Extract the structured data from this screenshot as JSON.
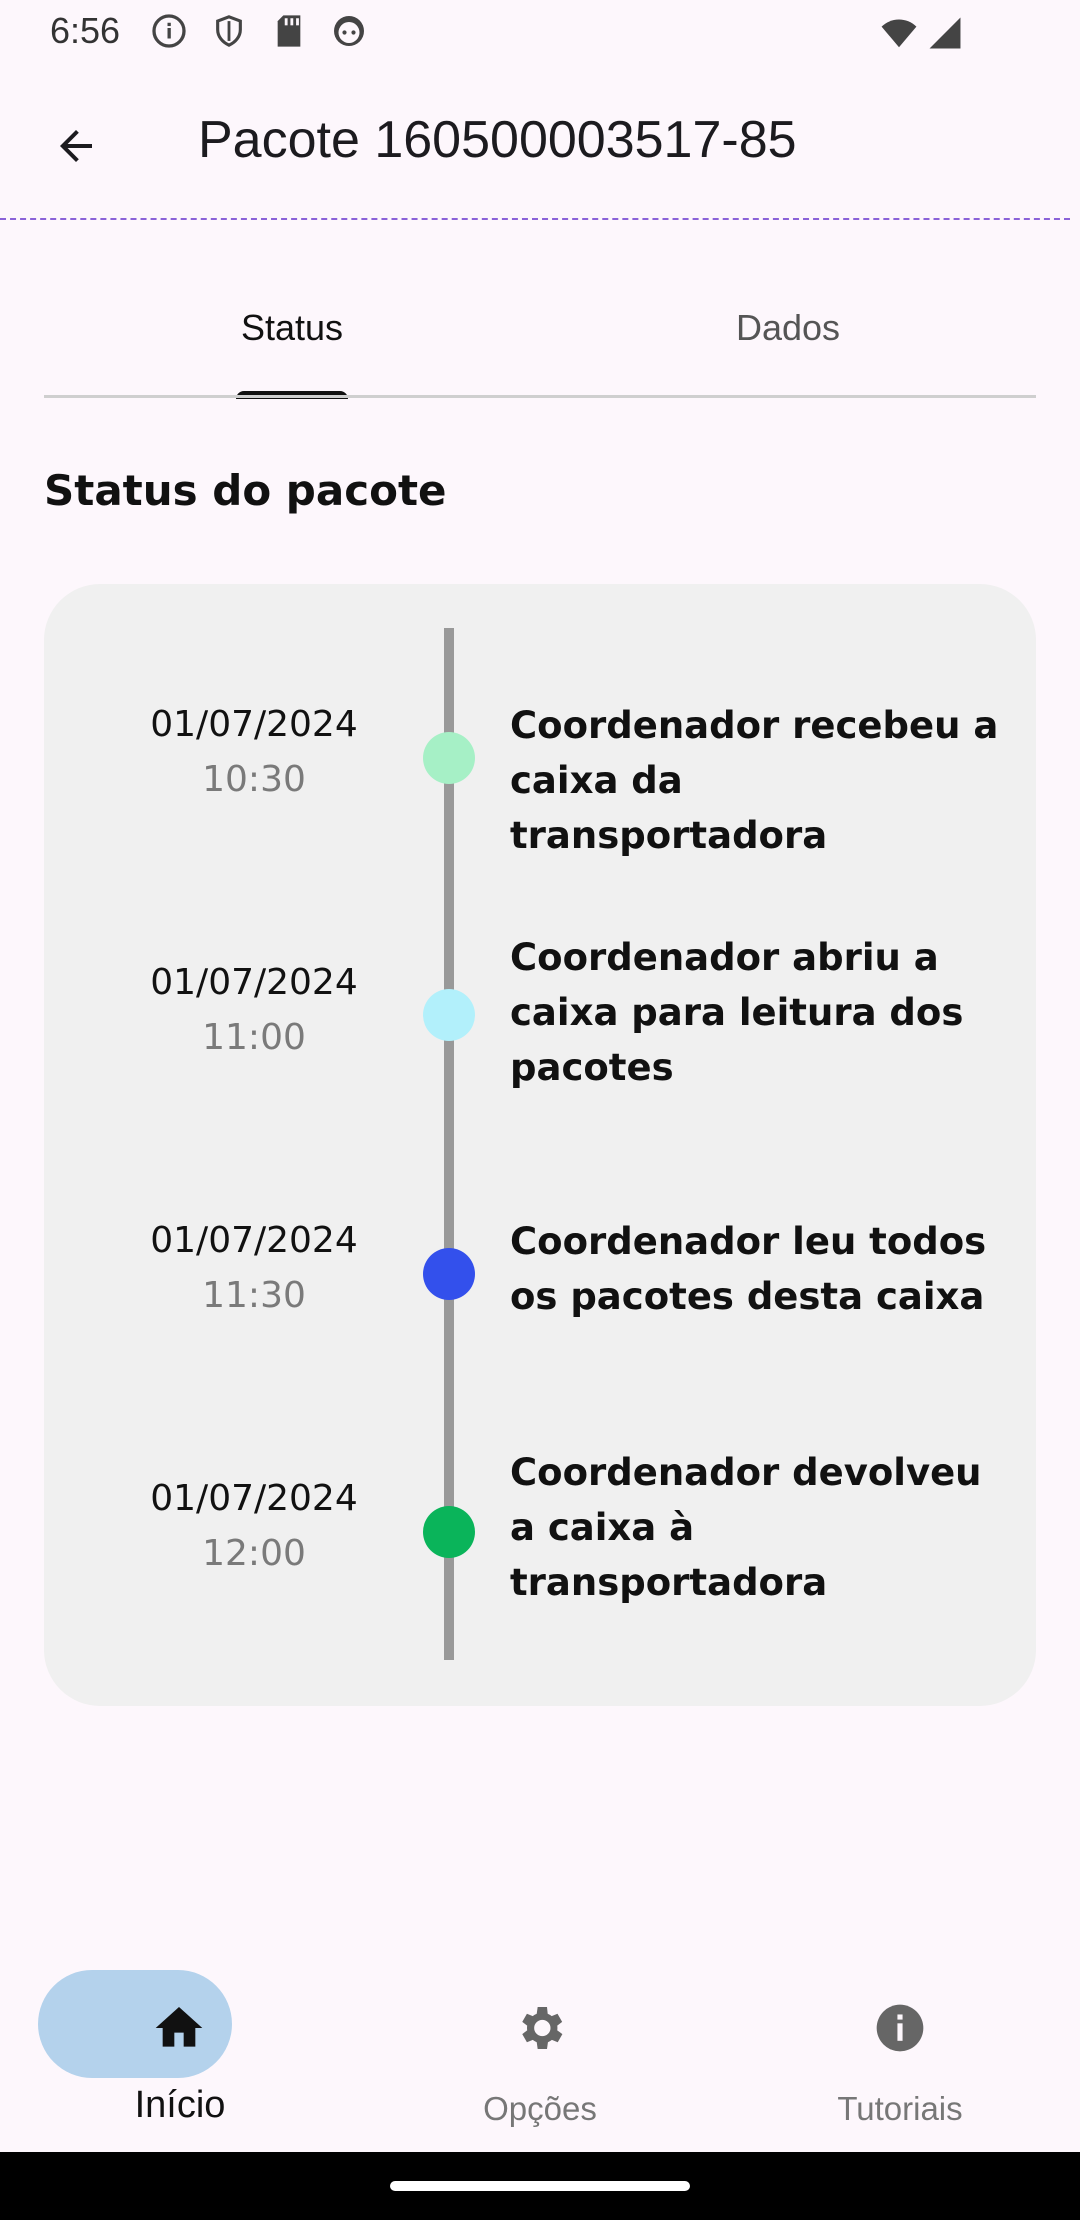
{
  "status_bar": {
    "time": "6:56",
    "icons": [
      "info-icon",
      "shield-icon",
      "sd-card-icon",
      "android-face-icon",
      "wifi-icon",
      "signal-icon"
    ]
  },
  "header": {
    "title": "Pacote 160500003517-85",
    "back_icon": "arrow-left-icon"
  },
  "tabs": [
    {
      "label": "Status",
      "selected": true
    },
    {
      "label": "Dados",
      "selected": false
    }
  ],
  "section_title": "Status do pacote",
  "timeline": [
    {
      "date": "01/07/2024",
      "time": "10:30",
      "description_lines": [
        "Coordenador recebeu a",
        "caixa da transportadora"
      ],
      "dot_color": "#a6f0c6"
    },
    {
      "date": "01/07/2024",
      "time": "11:00",
      "description_lines": [
        "Coordenador abriu a",
        "caixa para leitura dos",
        "pacotes"
      ],
      "dot_color": "#b2f0fb"
    },
    {
      "date": "01/07/2024",
      "time": "11:30",
      "description_lines": [
        "Coordenador leu todos",
        "os pacotes desta caixa"
      ],
      "dot_color": "#3350ec"
    },
    {
      "date": "01/07/2024",
      "time": "12:00",
      "description_lines": [
        "Coordenador devolveu",
        "a caixa à",
        "transportadora"
      ],
      "dot_color": "#0ab45a"
    }
  ],
  "bottom_nav": [
    {
      "label": "Início",
      "icon": "home-icon",
      "selected": true
    },
    {
      "label": "Opções",
      "icon": "gear-icon",
      "selected": false
    },
    {
      "label": "Tutoriais",
      "icon": "info-icon",
      "selected": false
    }
  ],
  "colors": {
    "background": "#fdf7fc",
    "accent_dashed": "#8a62d8",
    "card": "#f0f0f0",
    "nav_selected_pill": "#b4d2ec"
  }
}
